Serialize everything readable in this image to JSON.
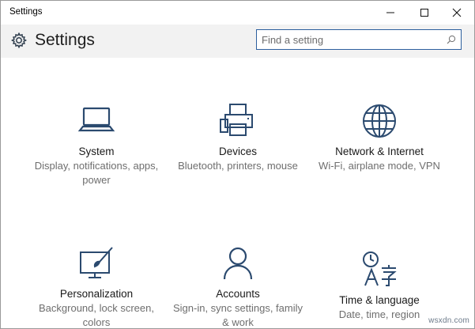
{
  "window": {
    "title": "Settings",
    "controls": [
      "minimize-icon",
      "maximize-icon",
      "close-icon"
    ]
  },
  "header": {
    "icon": "gear-icon",
    "title": "Settings",
    "search_placeholder": "Find a setting",
    "search_value": "",
    "search_icon": "search-icon"
  },
  "tiles": [
    {
      "name": "System",
      "desc": "Display, notifications, apps, power",
      "icon": "laptop-icon"
    },
    {
      "name": "Devices",
      "desc": "Bluetooth, printers, mouse",
      "icon": "devices-icon"
    },
    {
      "name": "Network & Internet",
      "desc": "Wi-Fi, airplane mode, VPN",
      "icon": "globe-icon"
    },
    {
      "name": "Personalization",
      "desc": "Background, lock screen, colors",
      "icon": "personalization-icon"
    },
    {
      "name": "Accounts",
      "desc": "Sign-in, sync settings, family & work",
      "icon": "person-icon"
    },
    {
      "name": "Time & language",
      "desc": "Date, time, region",
      "icon": "time-language-icon"
    }
  ],
  "colors": {
    "accent": "#2d5f9e",
    "icon": "#2b4a6f",
    "header_bg": "#f2f2f2",
    "desc_text": "#6e6e6e"
  },
  "watermark": "wsxdn.com"
}
